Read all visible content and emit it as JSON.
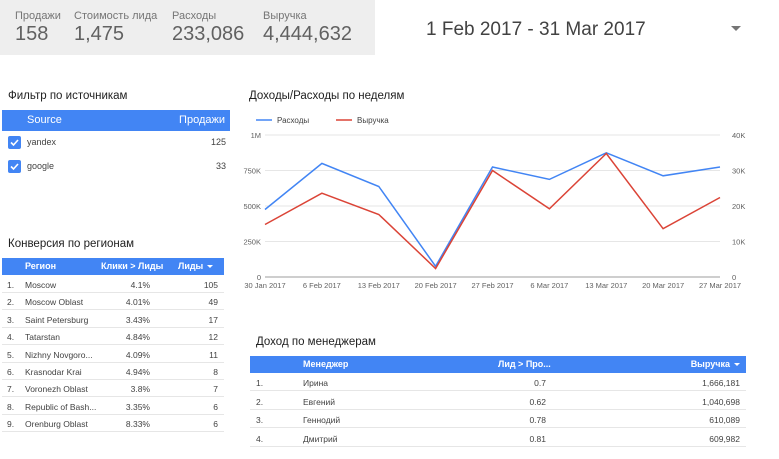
{
  "kpis": [
    {
      "label": "Продажи",
      "value": "158"
    },
    {
      "label": "Стоимость лида",
      "value": "1,475"
    },
    {
      "label": "Расходы",
      "value": "233,086"
    },
    {
      "label": "Выручка",
      "value": "4,444,632"
    }
  ],
  "date_range": {
    "label": "1 Feb 2017 - 31 Mar 2017"
  },
  "source_filter": {
    "title": "Фильтр по источникам",
    "headers": {
      "source": "Source",
      "sales": "Продажи"
    },
    "rows": [
      {
        "name": "yandex",
        "value": "125",
        "checked": true
      },
      {
        "name": "google",
        "value": "33",
        "checked": true
      }
    ]
  },
  "regions": {
    "title": "Конверсия по регионам",
    "headers": {
      "region": "Регион",
      "conv": "Клики > Лиды",
      "leads": "Лиды"
    },
    "rows": [
      {
        "n": "1.",
        "region": "Moscow",
        "conv": "4.1%",
        "leads": "105"
      },
      {
        "n": "2.",
        "region": "Moscow Oblast",
        "conv": "4.01%",
        "leads": "49"
      },
      {
        "n": "3.",
        "region": "Saint Petersburg",
        "conv": "3.43%",
        "leads": "17"
      },
      {
        "n": "4.",
        "region": "Tatarstan",
        "conv": "4.84%",
        "leads": "12"
      },
      {
        "n": "5.",
        "region": "Nizhny Novgoro...",
        "conv": "4.09%",
        "leads": "11"
      },
      {
        "n": "6.",
        "region": "Krasnodar Krai",
        "conv": "4.94%",
        "leads": "8"
      },
      {
        "n": "7.",
        "region": "Voronezh Oblast",
        "conv": "3.8%",
        "leads": "7"
      },
      {
        "n": "8.",
        "region": "Republic of Bash...",
        "conv": "3.35%",
        "leads": "6"
      },
      {
        "n": "9.",
        "region": "Orenburg Oblast",
        "conv": "8.33%",
        "leads": "6"
      }
    ]
  },
  "managers": {
    "title": "Доход по менеджерам",
    "headers": {
      "manager": "Менеджер",
      "ratio": "Лид > Про...",
      "revenue": "Выручка"
    },
    "rows": [
      {
        "n": "1.",
        "manager": "Ирина",
        "ratio": "0.7",
        "revenue": "1,666,181"
      },
      {
        "n": "2.",
        "manager": "Евгений",
        "ratio": "0.62",
        "revenue": "1,040,698"
      },
      {
        "n": "3.",
        "manager": "Геннодий",
        "ratio": "0.78",
        "revenue": "610,089"
      },
      {
        "n": "4.",
        "manager": "Дмитрий",
        "ratio": "0.81",
        "revenue": "609,982"
      }
    ]
  },
  "colors": {
    "accent": "#4285f4",
    "series_expense": "#4285f4",
    "series_revenue": "#db4437"
  },
  "chart_data": {
    "type": "line",
    "title": "Доходы/Расходы по неделям",
    "x": [
      "30 Jan 2017",
      "6 Feb 2017",
      "13 Feb 2017",
      "20 Feb 2017",
      "27 Feb 2017",
      "6 Mar 2017",
      "13 Mar 2017",
      "20 Mar 2017",
      "27 Mar 2017"
    ],
    "left_axis": {
      "ticks": [
        "0",
        "250K",
        "500K",
        "750K",
        "1M"
      ],
      "ylim": [
        0,
        1000000
      ]
    },
    "right_axis": {
      "ticks": [
        "0",
        "10K",
        "20K",
        "30K",
        "40K"
      ],
      "ylim": [
        0,
        40000
      ]
    },
    "series": [
      {
        "name": "Расходы",
        "axis": "right",
        "color": "#4285f4",
        "values": [
          19000,
          32000,
          25500,
          3000,
          31000,
          27500,
          35000,
          28500,
          31000
        ]
      },
      {
        "name": "Выручка",
        "axis": "left",
        "color": "#db4437",
        "values": [
          370000,
          590000,
          440000,
          60000,
          750000,
          480000,
          870000,
          340000,
          560000
        ]
      }
    ],
    "legend": "top-left",
    "grid": true
  }
}
